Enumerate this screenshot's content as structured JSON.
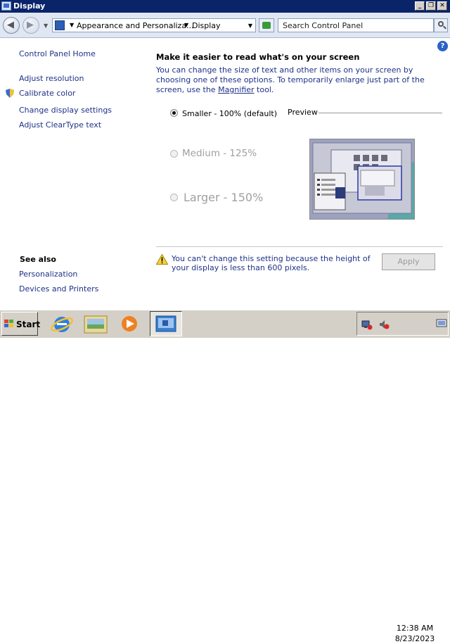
{
  "window": {
    "title": "Display",
    "controls": {
      "minimize": "_",
      "restore": "❐",
      "close": "✕"
    }
  },
  "address_bar": {
    "crumbs": [
      "Appearance and Personaliza...",
      "Display"
    ],
    "search_placeholder": "Search Control Panel"
  },
  "sidebar": {
    "home": "Control Panel Home",
    "links": [
      "Adjust resolution",
      "Calibrate color",
      "Change display settings",
      "Adjust ClearType text"
    ],
    "see_also_title": "See also",
    "see_also": [
      "Personalization",
      "Devices and Printers"
    ]
  },
  "main": {
    "heading": "Make it easier to read what's on your screen",
    "description_before": "You can change the size of text and other items on your screen by choosing one of these options. To temporarily enlarge just part of the screen, use the ",
    "description_link": "Magnifier",
    "description_after": " tool.",
    "options": [
      {
        "label": "Smaller - 100% (default)",
        "selected": true,
        "enabled": true
      },
      {
        "label": "Medium - 125%",
        "selected": false,
        "enabled": false
      },
      {
        "label": "Larger - 150%",
        "selected": false,
        "enabled": false
      }
    ],
    "preview_label": "Preview",
    "warning": "You can't change this setting because the height of your display is less than 600 pixels.",
    "apply_label": "Apply",
    "help": "?"
  },
  "taskbar": {
    "start_label": "Start",
    "apps": [
      "internet-explorer-icon",
      "explorer-icon",
      "media-player-icon",
      "control-panel-icon"
    ],
    "clock_time": "12:38 AM",
    "clock_date": "8/23/2023"
  },
  "colors": {
    "titlebar": "#0a246a",
    "link": "#1e3287",
    "disabled": "#a0a0a0"
  }
}
